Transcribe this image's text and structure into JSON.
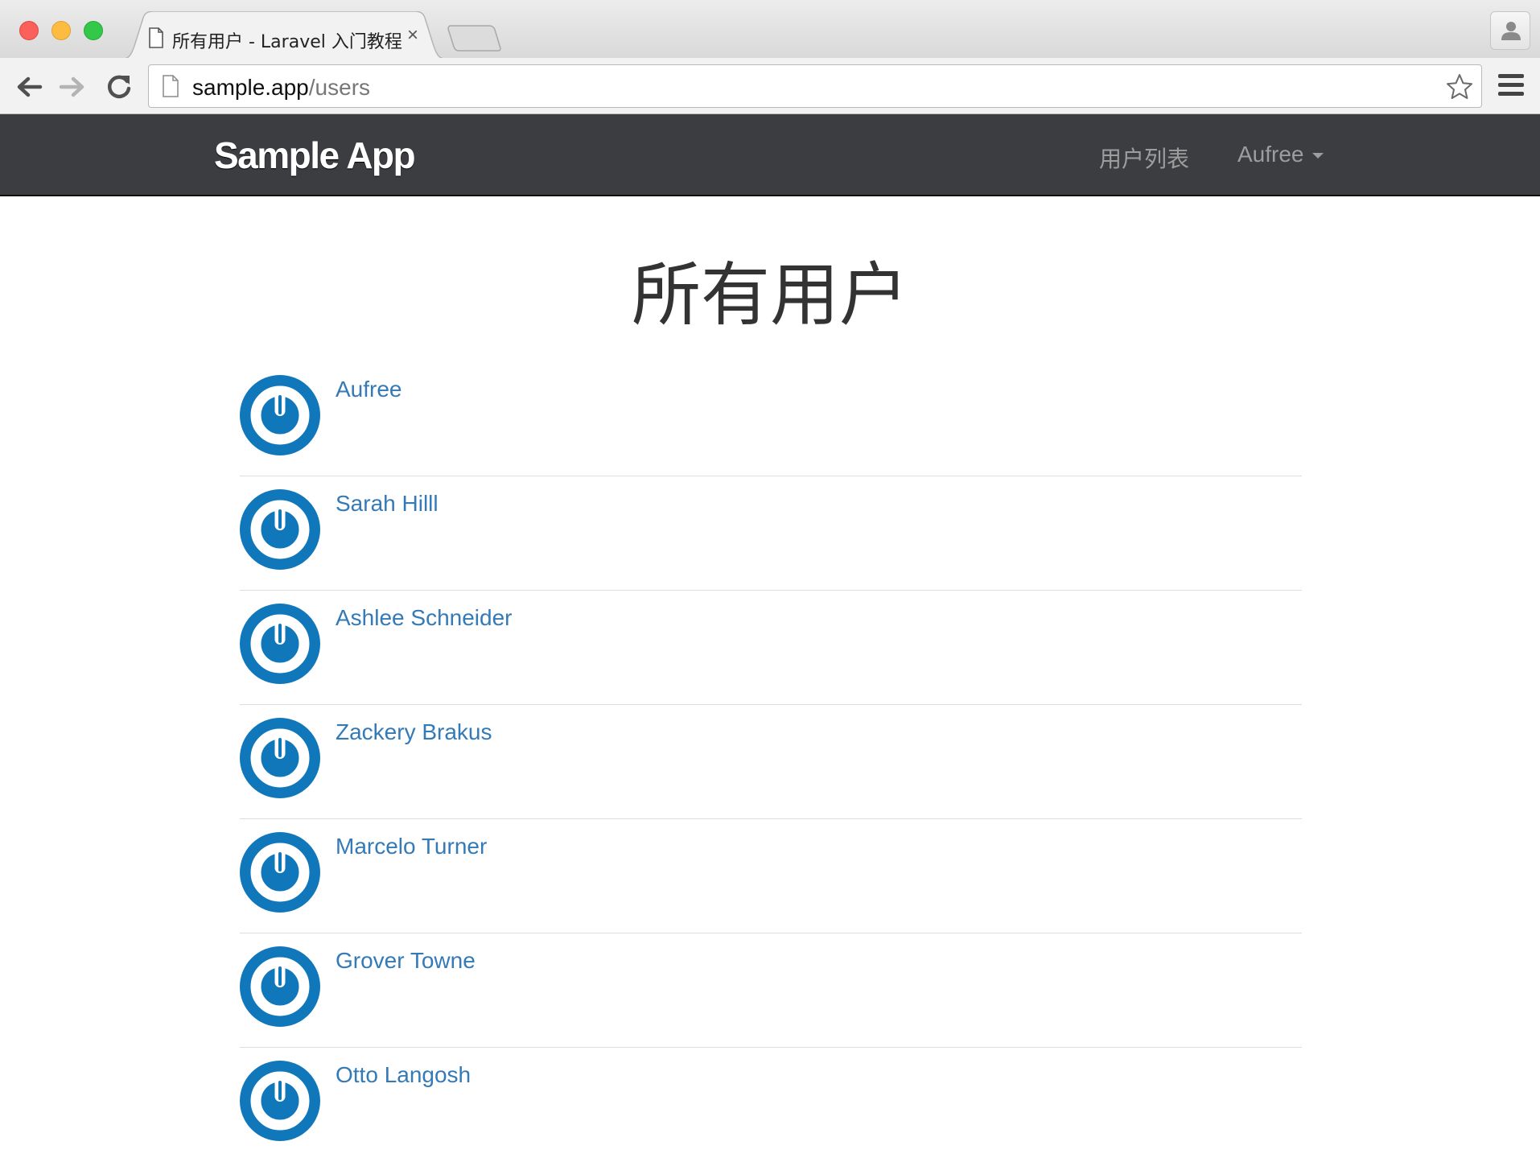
{
  "browser": {
    "tab_title": "所有用户 - Laravel 入门教程",
    "tab_close": "×",
    "url_host": "sample.app",
    "url_path": "/users"
  },
  "navbar": {
    "brand": "Sample App",
    "users_link": "用户列表",
    "current_user": "Aufree"
  },
  "page": {
    "title": "所有用户"
  },
  "users": [
    {
      "name": "Aufree"
    },
    {
      "name": "Sarah Hilll"
    },
    {
      "name": "Ashlee Schneider"
    },
    {
      "name": "Zackery Brakus"
    },
    {
      "name": "Marcelo Turner"
    },
    {
      "name": "Grover Towne"
    },
    {
      "name": "Otto Langosh"
    }
  ],
  "colors": {
    "navbar_bg": "#3c3d41",
    "link": "#337ab7",
    "avatar": "#1177bb"
  },
  "icons": {
    "avatar": "gravatar-power-icon"
  }
}
